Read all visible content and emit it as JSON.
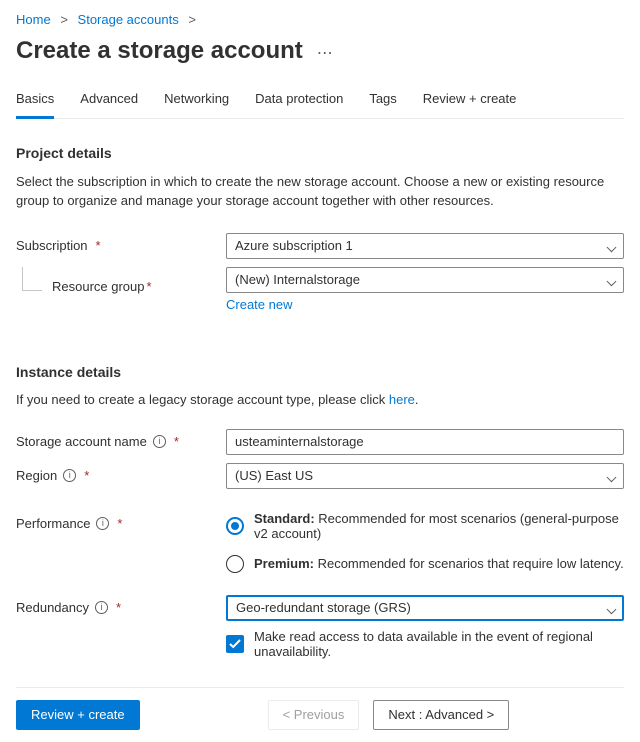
{
  "breadcrumb": {
    "home": "Home",
    "storage": "Storage accounts"
  },
  "page_title": "Create a storage account",
  "tabs": [
    "Basics",
    "Advanced",
    "Networking",
    "Data protection",
    "Tags",
    "Review + create"
  ],
  "project": {
    "heading": "Project details",
    "desc": "Select the subscription in which to create the new storage account. Choose a new or existing resource group to organize and manage your storage account together with other resources.",
    "subscription_label": "Subscription",
    "subscription_value": "Azure subscription 1",
    "resource_group_label": "Resource group",
    "resource_group_value": "(New) Internalstorage",
    "create_new": "Create new"
  },
  "instance": {
    "heading": "Instance details",
    "legacy_prefix": "If you need to create a legacy storage account type, please click ",
    "legacy_link": "here",
    "name_label": "Storage account name",
    "name_value": "usteaminternalstorage",
    "region_label": "Region",
    "region_value": "(US) East US",
    "perf_label": "Performance",
    "perf_standard_title": "Standard:",
    "perf_standard_desc": " Recommended for most scenarios (general-purpose v2 account)",
    "perf_premium_title": "Premium:",
    "perf_premium_desc": " Recommended for scenarios that require low latency.",
    "redundancy_label": "Redundancy",
    "redundancy_value": "Geo-redundant storage (GRS)",
    "read_access": "Make read access to data available in the event of regional unavailability."
  },
  "footer": {
    "review": "Review + create",
    "previous": "< Previous",
    "next": "Next : Advanced >"
  }
}
